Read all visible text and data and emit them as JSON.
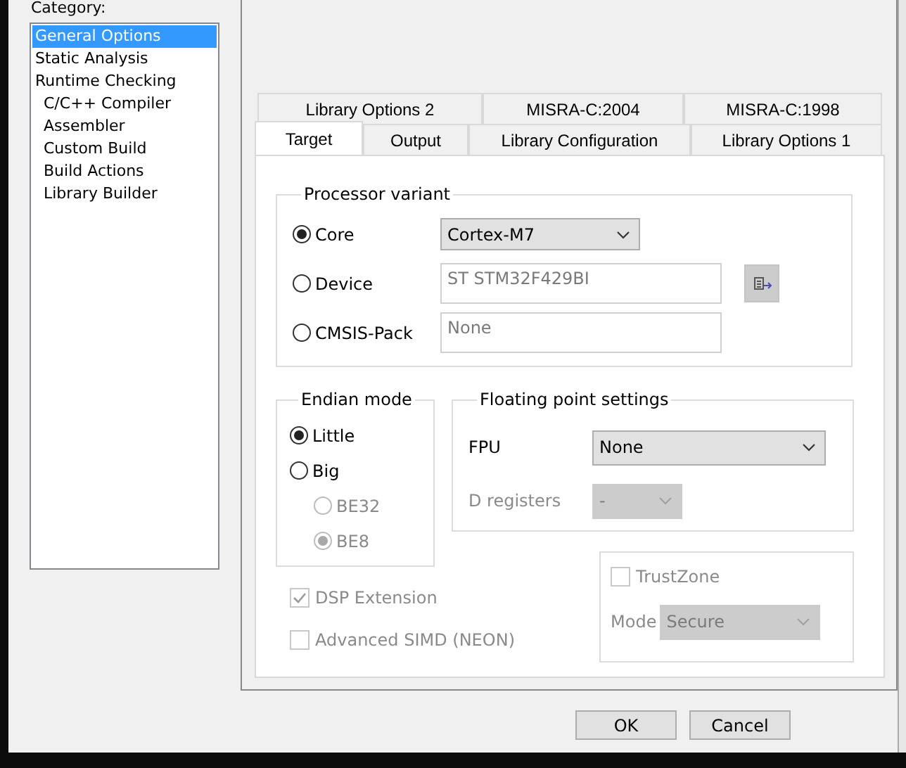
{
  "category_label": "Category:",
  "categories": [
    {
      "label": "General Options",
      "selected": true
    },
    {
      "label": "Static Analysis",
      "selected": false
    },
    {
      "label": "Runtime Checking",
      "selected": false,
      "children": [
        {
          "label": "C/C++ Compiler",
          "selected": false
        },
        {
          "label": "Assembler",
          "selected": false
        },
        {
          "label": "Custom Build",
          "selected": false
        },
        {
          "label": "Build Actions",
          "selected": false
        },
        {
          "label": "Library Builder",
          "selected": false
        }
      ]
    }
  ],
  "tab_rows": [
    [
      {
        "label": "Library Options 2",
        "selected": false
      },
      {
        "label": "MISRA-C:2004",
        "selected": false
      },
      {
        "label": "MISRA-C:1998",
        "selected": false
      }
    ],
    [
      {
        "label": "Target",
        "selected": true
      },
      {
        "label": "Output",
        "selected": false
      },
      {
        "label": "Library Configuration",
        "selected": false
      },
      {
        "label": "Library Options 1",
        "selected": false
      }
    ]
  ],
  "processor_variant": {
    "title": "Processor variant",
    "options": [
      {
        "label": "Core",
        "selected": true,
        "kind": "dropdown",
        "value": "Cortex-M7",
        "disabled": false
      },
      {
        "label": "Device",
        "selected": false,
        "kind": "field",
        "value": "ST STM32F429BI",
        "disabled": true,
        "has_button": true
      },
      {
        "label": "CMSIS-Pack",
        "selected": false,
        "kind": "field",
        "value": "None",
        "disabled": true
      }
    ]
  },
  "endian_mode": {
    "title": "Endian mode",
    "options": [
      {
        "label": "Little",
        "selected": true,
        "disabled": false,
        "sub": false
      },
      {
        "label": "Big",
        "selected": false,
        "disabled": false,
        "sub": false
      },
      {
        "label": "BE32",
        "selected": false,
        "disabled": true,
        "sub": true
      },
      {
        "label": "BE8",
        "selected": true,
        "disabled": true,
        "sub": true
      }
    ]
  },
  "floating_point": {
    "title": "Floating point settings",
    "rows": [
      {
        "label": "FPU",
        "value": "None",
        "disabled": false
      },
      {
        "label": "D registers",
        "value": "-",
        "disabled": true
      }
    ]
  },
  "extensions": [
    {
      "label": "DSP Extension",
      "checked": true,
      "disabled": true
    },
    {
      "label": "Advanced SIMD (NEON)",
      "checked": false,
      "disabled": true
    }
  ],
  "trustzone": {
    "label": "TrustZone",
    "checked": false,
    "disabled": true,
    "mode_label": "Mode",
    "mode_value": "Secure"
  },
  "buttons": [
    "OK",
    "Cancel"
  ]
}
